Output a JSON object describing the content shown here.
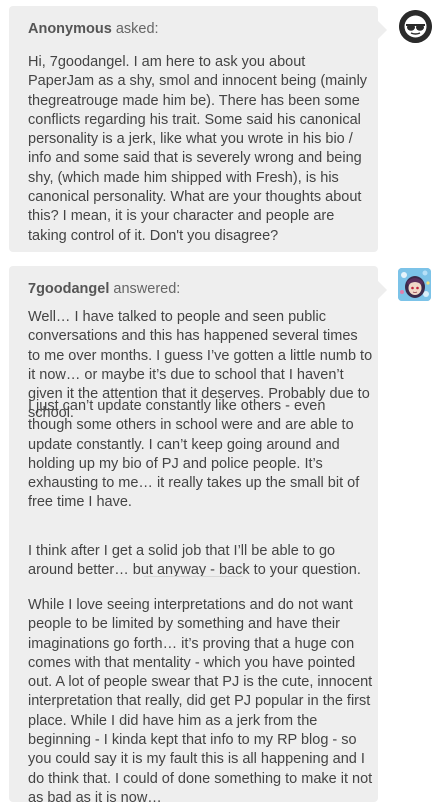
{
  "ask": {
    "asker_name": "Anonymous",
    "asked_word": "asked:",
    "question": "Hi, 7goodangel. I am here to ask you about PaperJam as a shy, smol and innocent being (mainly thegreatrouge made him be). There has been some conflicts regarding his trait. Some said his canonical personality is a jerk, like what you wrote in his bio / info and some said that is severely wrong and being shy, (which made him shipped with Fresh), is his canonical personality. What are your thoughts about this? I mean, it is your character and people are taking control of it. Don't you disagree?",
    "avatar_icon": "anonymous-sunglasses-icon"
  },
  "answer": {
    "author_name": "7goodangel",
    "answered_word": "answered:",
    "paragraphs": [
      "Well… I have talked to people and seen public conversations and this has happened several times to me over months. I guess I’ve gotten a little numb to it now… or maybe it’s due to school that I haven’t given it the attention that it deserves. Probably due to school.",
      "I just can’t update constantly like others - even though some others in school were and are able to update constantly. I can’t keep going around and holding up my bio of PJ and police people. It’s exhausting to me… it really takes up the small bit of free time I have.",
      "I think after I get a solid job that I’ll be able to go around better… but anyway - back to your question.",
      "While I love seeing interpretations and do not want people to be limited by something and have their imaginations go forth… it’s proving that a huge con comes with that mentality - which you have pointed out. A lot of people swear that PJ is the cute, innocent interpretation that really, did get PJ popular in the first place. While I did have him as a jerk from the beginning - I kinda kept that info to my RP blog - so you could say it is my fault this is all happening and I do think that. I could of done something to make it not as bad as it is now…"
    ],
    "avatar_icon": "character-avatar-icon"
  }
}
